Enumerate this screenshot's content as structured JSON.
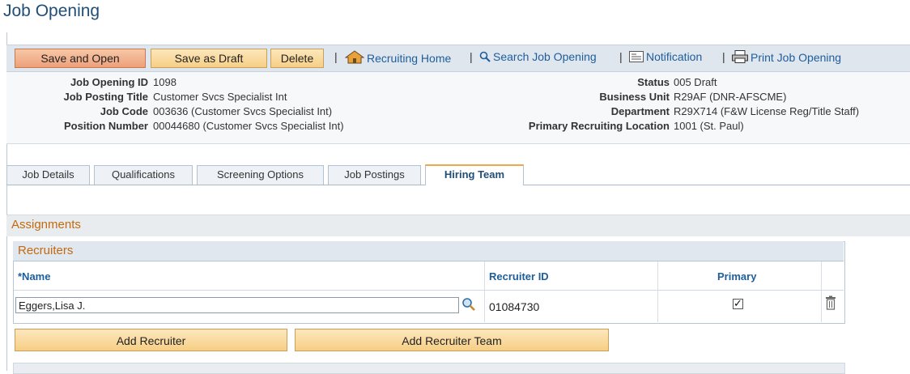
{
  "page": {
    "title": "Job Opening"
  },
  "toolbar": {
    "save_open": "Save and Open",
    "save_draft": "Save as Draft",
    "delete": "Delete",
    "recruiting_home": "Recruiting Home",
    "search_job_opening": "Search Job Opening",
    "notification": "Notification",
    "print_job_opening": "Print Job Opening",
    "separator": "|"
  },
  "header": {
    "left": [
      {
        "label": "Job Opening ID",
        "value": "1098"
      },
      {
        "label": "Job Posting Title",
        "value": "Customer Svcs Specialist Int"
      },
      {
        "label": "Job Code",
        "value": "003636 (Customer Svcs Specialist Int)"
      },
      {
        "label": "Position Number",
        "value": "00044680 (Customer Svcs Specialist Int)"
      }
    ],
    "right": [
      {
        "label": "Status",
        "value": "005 Draft"
      },
      {
        "label": "Business Unit",
        "value": "R29AF (DNR-AFSCME)"
      },
      {
        "label": "Department",
        "value": "R29X714 (F&W License Reg/Title Staff)"
      },
      {
        "label": "Primary Recruiting Location",
        "value": "1001 (St. Paul)"
      }
    ]
  },
  "tabs": [
    {
      "label": "Job Details",
      "active": false
    },
    {
      "label": "Qualifications",
      "active": false
    },
    {
      "label": "Screening Options",
      "active": false
    },
    {
      "label": "Job Postings",
      "active": false
    },
    {
      "label": "Hiring Team",
      "active": true
    }
  ],
  "assignments": {
    "title": "Assignments",
    "recruiters": {
      "title": "Recruiters",
      "columns": {
        "name": "*Name",
        "recruiter_id": "Recruiter ID",
        "primary": "Primary"
      },
      "rows": [
        {
          "name": "Eggers,Lisa J.",
          "recruiter_id": "01084730",
          "primary": true,
          "primary_mark": "✓"
        }
      ]
    },
    "add_recruiter": "Add Recruiter",
    "add_recruiter_team": "Add Recruiter Team"
  },
  "icons": {
    "home": "home-icon",
    "search": "magnifier-icon",
    "notification": "notification-icon",
    "print": "printer-icon",
    "lookup": "lookup-icon",
    "delete_row": "trash-icon"
  },
  "colors": {
    "title": "#1f4e79",
    "link": "#1d5e9c",
    "section": "#c26a10",
    "button": "#f6cf85",
    "primary_button": "#eda07a"
  }
}
